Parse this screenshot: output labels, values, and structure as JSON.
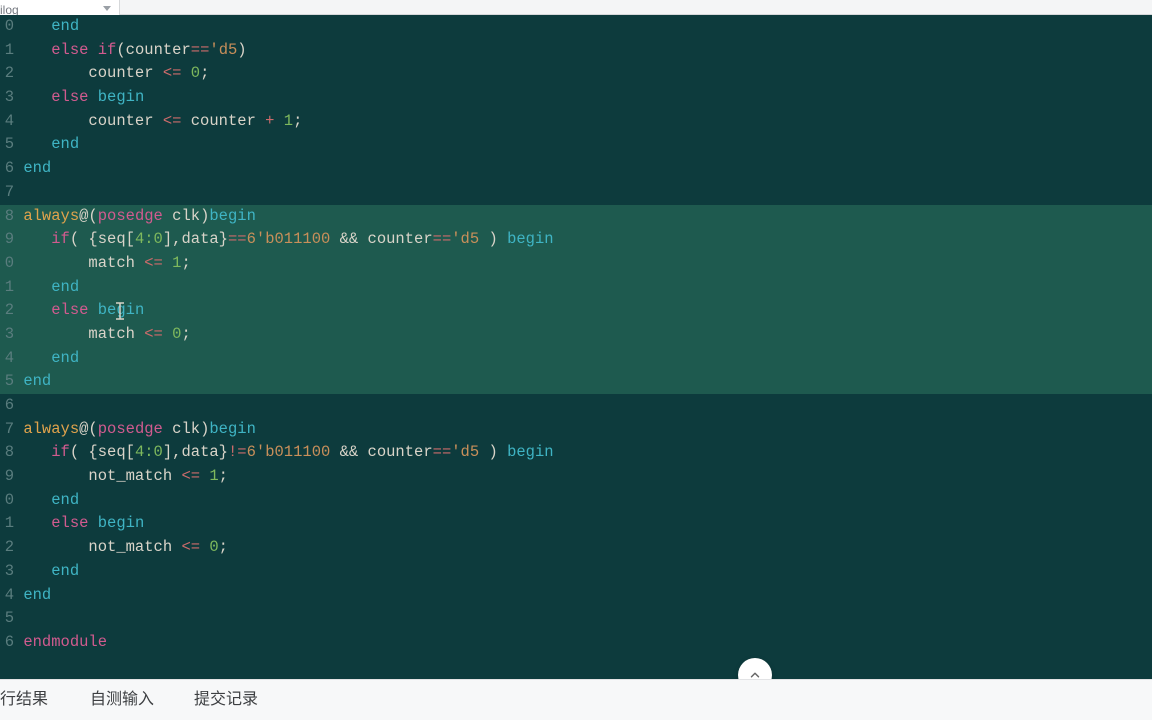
{
  "language_selector": "rilog",
  "tabs": {
    "results": "行结果",
    "selftest": "自测输入",
    "submissions": "提交记录"
  },
  "gutter": [
    "0",
    "1",
    "2",
    "3",
    "4",
    "5",
    "6",
    "7",
    "8",
    "9",
    "0",
    "1",
    "2",
    "3",
    "4",
    "5",
    "6",
    "7",
    "8",
    "9",
    "0",
    "1",
    "2",
    "3",
    "4",
    "5",
    "6"
  ],
  "code": {
    "l0_end": "end",
    "l1_else": "else",
    "l1_if": "if",
    "l1_lpar": "(counter",
    "l1_eq": "==",
    "l1_d5": "'d5",
    "l1_rpar": ")",
    "l2_counter": "counter ",
    "l2_le": "<=",
    "l2_sp": " ",
    "l2_zero": "0",
    "l2_sc": ";",
    "l3_else": "else",
    "l3_begin": "begin",
    "l4_counter": "counter ",
    "l4_le": "<=",
    "l4_rhs": " counter ",
    "l4_plus": "+",
    "l4_sp": " ",
    "l4_one": "1",
    "l4_sc": ";",
    "l5_end": "end",
    "l6_end": "end",
    "l8_always": "always",
    "l8_at": "@(",
    "l8_posedge": "posedge",
    "l8_clk": " clk)",
    "l8_begin": "begin",
    "l9_if": "if",
    "l9_open": "( {seq[",
    "l9_range": "4:0",
    "l9_mid": "],data}",
    "l9_eq": "==",
    "l9_lit": "6'b011100",
    "l9_and": " && counter",
    "l9_eq2": "==",
    "l9_d5": "'d5",
    "l9_close": " ) ",
    "l9_begin": "begin",
    "l10_match": "match ",
    "l10_le": "<=",
    "l10_sp": " ",
    "l10_one": "1",
    "l10_sc": ";",
    "l11_end": "end",
    "l12_else": "else",
    "l12_begin": "begin",
    "l13_match": "match ",
    "l13_le": "<=",
    "l13_sp": " ",
    "l13_zero": "0",
    "l13_sc": ";",
    "l14_end": "end",
    "l15_end": "end",
    "l17_always": "always",
    "l17_at": "@(",
    "l17_posedge": "posedge",
    "l17_clk": " clk)",
    "l17_begin": "begin",
    "l18_if": "if",
    "l18_open": "( {seq[",
    "l18_range": "4:0",
    "l18_mid": "],data}",
    "l18_ne": "!=",
    "l18_lit": "6'b011100",
    "l18_and": " && counter",
    "l18_eq": "==",
    "l18_d5": "'d5",
    "l18_close": " ) ",
    "l18_begin": "begin",
    "l19_nm": "not_match ",
    "l19_le": "<=",
    "l19_sp": " ",
    "l19_one": "1",
    "l19_sc": ";",
    "l20_end": "end",
    "l21_else": "else",
    "l21_begin": "begin",
    "l22_nm": "not_match ",
    "l22_le": "<=",
    "l22_sp": " ",
    "l22_zero": "0",
    "l22_sc": ";",
    "l23_end": "end",
    "l24_end": "end",
    "l26_endmodule": "endmodule"
  }
}
